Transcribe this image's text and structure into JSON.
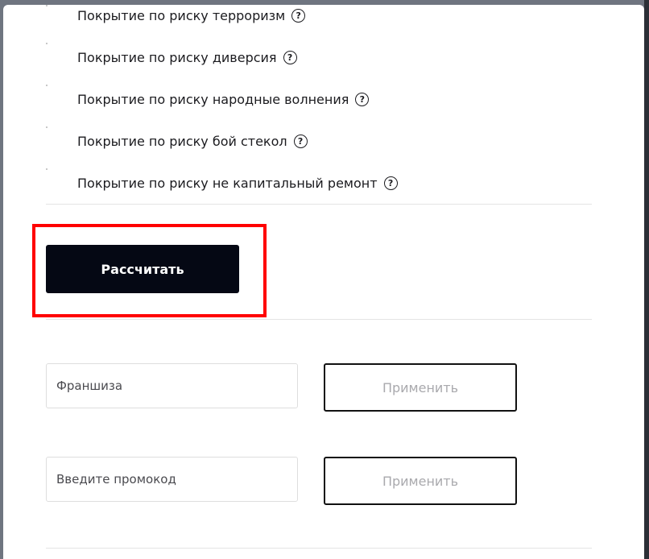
{
  "options": [
    {
      "label": "Покрытие по риску терроризм",
      "help": "?"
    },
    {
      "label": "Покрытие по риску диверсия",
      "help": "?"
    },
    {
      "label": "Покрытие по риску народные волнения",
      "help": "?"
    },
    {
      "label": "Покрытие по риску бой стекол",
      "help": "?"
    },
    {
      "label": "Покрытие по риску не капитальный ремонт",
      "help": "?"
    }
  ],
  "calculate": {
    "label": "Рассчитать"
  },
  "franchise": {
    "placeholder": "Франшиза",
    "value": "",
    "apply_label": "Применить"
  },
  "promo": {
    "placeholder": "Введите промокод",
    "value": "",
    "apply_label": "Применить"
  },
  "colors": {
    "highlight": "#ff0000",
    "primary_button": "#050814"
  }
}
